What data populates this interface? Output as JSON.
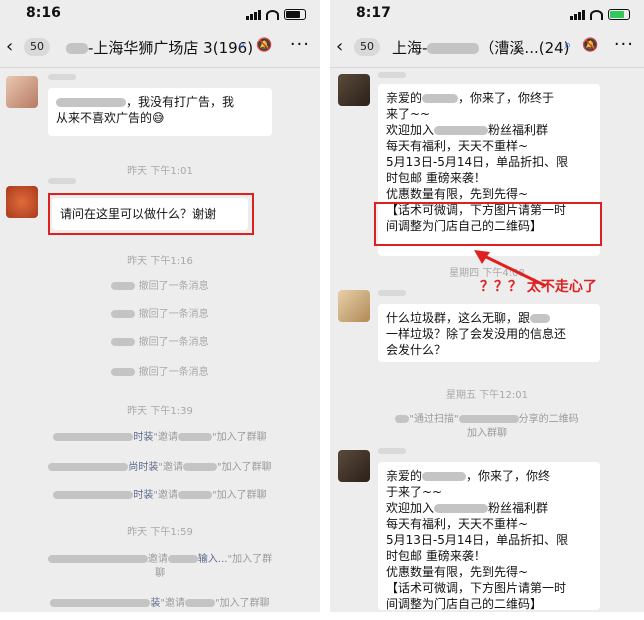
{
  "left": {
    "status_time": "8:16",
    "unread": "50",
    "title": "-上海华狮广场店 3(196)",
    "bubble1_line1": "，我没有打广告，我",
    "bubble1_line2": "从来不喜欢广告的",
    "bubble1_emoji": "😅",
    "time1": "昨天 下午1:01",
    "question": "请问在这里可以做什么？谢谢",
    "time2": "昨天 下午1:16",
    "recall": "撤回了一条消息",
    "time3": "昨天 下午1:39",
    "sys1": "时装",
    "sys1_mid": "\"邀请",
    "sys1_end": "\"加入了群聊",
    "sys2": "尚时装",
    "sys2_mid": "\"邀请",
    "sys2_end": "\"加入了群聊",
    "sys3": "时装",
    "sys3_mid": "\"邀请",
    "sys3_end": "\"加入了群聊",
    "time4": "昨天 下午1:59",
    "sys4_mid": "邀请",
    "sys4_hl": "输入...",
    "sys4_end": "\"加入了群",
    "sys4_end2": "聊",
    "sys5_hl": "装",
    "sys5_mid": "\"邀请",
    "sys5_end": "\"加入了群聊"
  },
  "right": {
    "status_time": "8:17",
    "unread": "50",
    "title_a": "上海-",
    "title_b": "（漕溪...",
    "title_c": "(24)",
    "m1": [
      "亲爱的",
      "，你来了，你终于",
      "来了~~",
      "欢迎加入",
      "粉丝福利群",
      "每天有福利，天天不重样~",
      "5月13日-5月14日，单品折扣、限",
      "时包邮 重磅来袭！",
      "优惠数量有限，先到先得~",
      "【话术可微调，下方图片请第一时",
      "间调整为门店自己的二维码】"
    ],
    "time1": "星期四 下午4:08",
    "annotation": "？？？ 太不走心了",
    "m2": [
      "什么垃圾群，这么无聊，跟",
      "一样垃圾？除了会发没用的信息还",
      "会发什么？"
    ],
    "time2": "星期五 下午12:01",
    "sys_a": "\"通过扫描\"",
    "sys_b": "分享的二维码",
    "sys_c": "加入群聊",
    "m3": [
      "亲爱的",
      "，你来了，你终",
      "于来了~~",
      "欢迎加入",
      "粉丝福利群",
      "每天有福利，天天不重样~",
      "5月13日-5月14日，单品折扣、限",
      "时包邮 重磅来袭！",
      "优惠数量有限，先到先得~",
      "【话术可微调，下方图片请第一时",
      "间调整为门店自己的二维码】"
    ]
  },
  "colors": {
    "red": "#e02020",
    "chat_bg": "#ededed",
    "bubble": "#ffffff",
    "system_text": "#a8a8a8"
  },
  "icons": [
    "back-chevron-icon",
    "signal-icon",
    "wifi-icon",
    "battery-icon",
    "search-icon",
    "mute-icon",
    "more-icon"
  ]
}
